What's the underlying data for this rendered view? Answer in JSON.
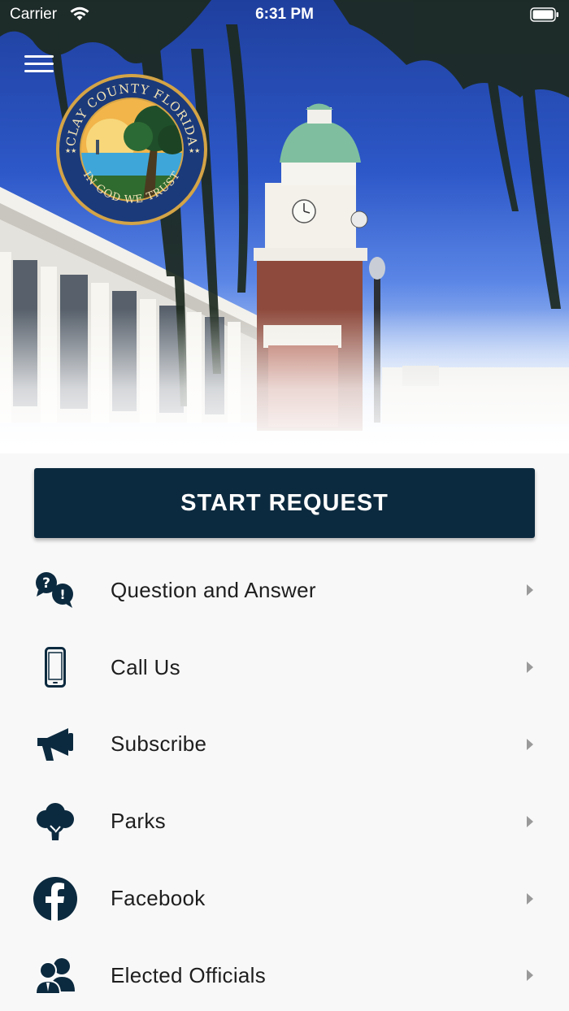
{
  "status_bar": {
    "carrier": "Carrier",
    "time": "6:31 PM"
  },
  "header": {
    "menu_icon": "hamburger-menu-icon",
    "seal": {
      "top_text": "CLAY COUNTY FLORIDA",
      "bottom_text": "IN GOD WE TRUST"
    }
  },
  "start_request": {
    "label": "START REQUEST"
  },
  "menu": [
    {
      "label": "Question and Answer",
      "icon": "question-answer-icon"
    },
    {
      "label": "Call Us",
      "icon": "phone-icon"
    },
    {
      "label": "Subscribe",
      "icon": "megaphone-icon"
    },
    {
      "label": "Parks",
      "icon": "tree-icon"
    },
    {
      "label": "Facebook",
      "icon": "facebook-icon"
    },
    {
      "label": "Elected Officials",
      "icon": "people-icon"
    }
  ],
  "colors": {
    "primary": "#0c2a3f",
    "background": "#f8f8f8",
    "sky": "#2d58c8",
    "seal_blue": "#1b3a7a",
    "seal_gold": "#d4a446"
  }
}
